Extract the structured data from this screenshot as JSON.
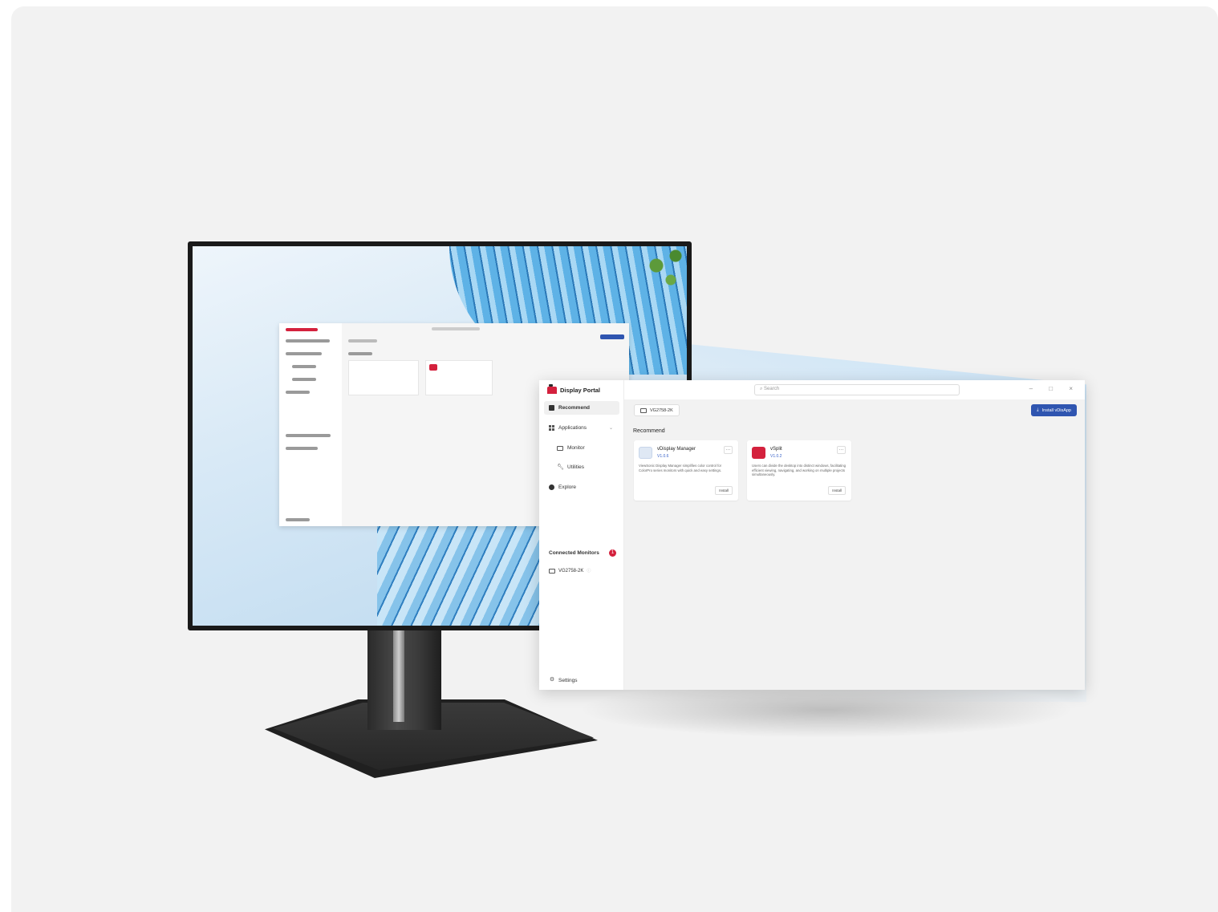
{
  "app": {
    "brand": "Display Portal",
    "search_placeholder": "Search",
    "window_controls": "– □ ×"
  },
  "sidebar": {
    "items": [
      {
        "label": "Recommend",
        "icon": "recommend-icon",
        "active": true
      },
      {
        "label": "Applications",
        "icon": "grid-icon",
        "expandable": true
      },
      {
        "label": "Monitor",
        "icon": "monitor-icon",
        "sub": true
      },
      {
        "label": "Utilities",
        "icon": "wrench-icon",
        "sub": true
      },
      {
        "label": "Explore",
        "icon": "explore-icon"
      }
    ],
    "connected_label": "Connected Monitors",
    "connected_count": "1",
    "device_label": "VG2758-2K",
    "settings_label": "Settings"
  },
  "toolbar": {
    "monitor_chip": "VG2758-2K",
    "install_label": "Install vDisApp"
  },
  "main": {
    "section_title": "Recommend",
    "apps": [
      {
        "name": "vDisplay Manager",
        "version": "V1.0.6",
        "description": "ViewSonic Display Manager simplifies color control for ColorPro series monitors with quick and easy settings.",
        "install_label": "Install",
        "icon_color": "#dfe8f4"
      },
      {
        "name": "vSplit",
        "version": "V1.0.2",
        "description": "Users can divide the desktop into distinct windows, facilitating efficient viewing, navigating, and working on multiple projects simultaneously.",
        "install_label": "Install",
        "icon_color": "#d4213d"
      }
    ]
  },
  "colors": {
    "accent": "#2f55b0",
    "brand_red": "#d4213d",
    "version_blue": "#3b64c9"
  }
}
